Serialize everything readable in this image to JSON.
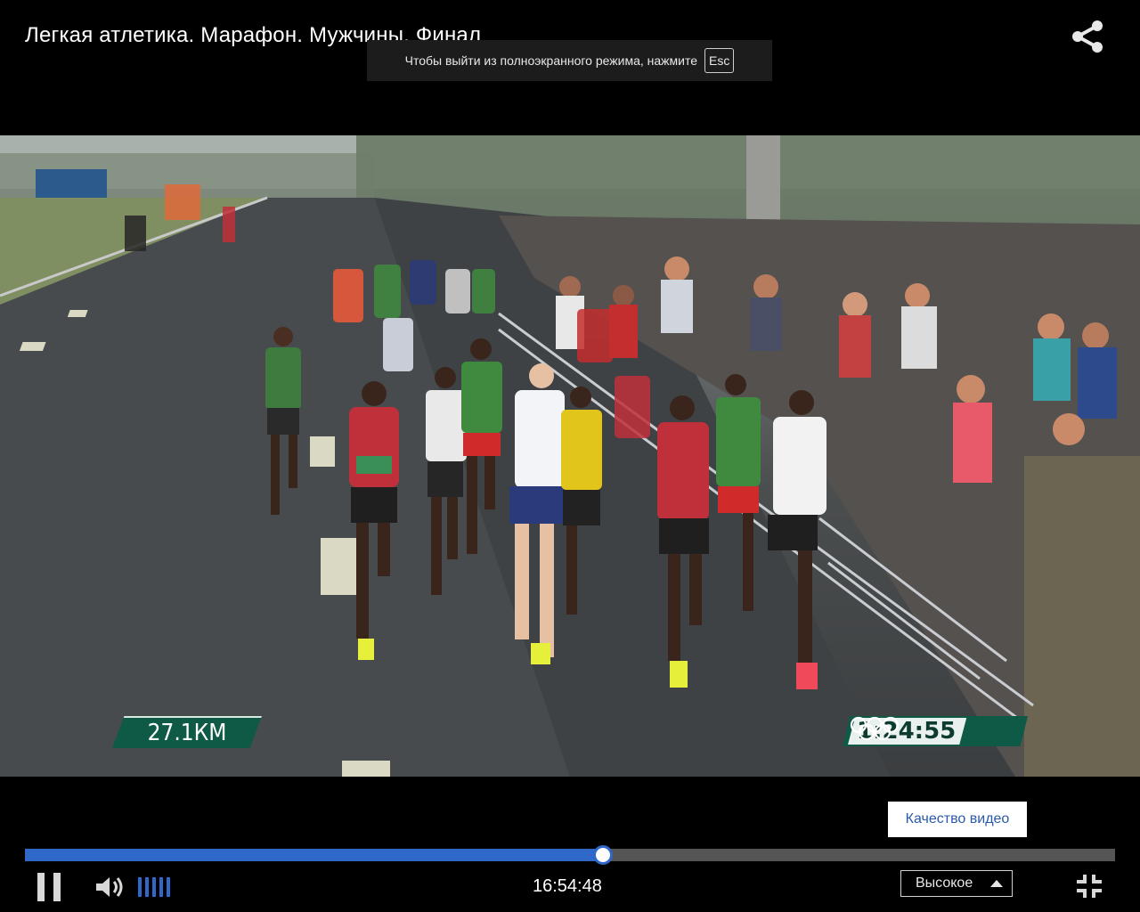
{
  "player": {
    "title": "Легкая атлетика. Марафон. Мужчины. Финал",
    "share_icon": "share-icon"
  },
  "fullscreen_notice": {
    "text": "Чтобы выйти из полноэкранного режима, нажмите",
    "key": "Esc"
  },
  "overlay": {
    "distance": "27.1КМ",
    "race_clock": "1:24:55",
    "rings_icon": "olympic-rings-icon"
  },
  "controls": {
    "quality_tooltip": "Качество видео",
    "progress_fraction": 0.53,
    "timecode": "16:54:48",
    "quality_value": "Высокое",
    "volume_level_bars": 5,
    "pause_icon": "pause-icon",
    "volume_icon": "speaker-icon",
    "exit_fullscreen_icon": "exit-fullscreen-icon"
  },
  "colors": {
    "accent": "#2f68c8",
    "overlay_green": "#0e5a46"
  }
}
